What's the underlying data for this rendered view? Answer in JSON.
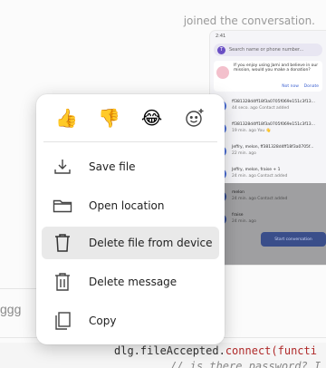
{
  "conversation": {
    "joined_text": "joined the conversation."
  },
  "phone_preview": {
    "status_time": "2:41",
    "search_avatar": "T",
    "search_placeholder": "Search name or phone number...",
    "promo_text": "If you enjoy using Jami and believe in our mission, would you make a donation?",
    "promo_not_now": "Not now",
    "promo_donate": "Donate",
    "rows": [
      {
        "title": "ff381328d4ff18f3a0705f069e151c3f13...",
        "sub": "44 seco. ago  Contact added"
      },
      {
        "title": "ff381328d4ff18f3a0705f069e151c3f13...",
        "sub": "19 min. ago  You 👋"
      },
      {
        "title": "Jeffry, melon, ff381328d4ff18f3a0705f...",
        "sub": "22 min. ago"
      },
      {
        "title": "Jeffry, melon, fraise + 1",
        "sub": "24 min. ago  Contact added"
      },
      {
        "title": "melon",
        "sub": "24 min. ago  Contact added"
      },
      {
        "title": "fraise",
        "sub": "24 min. ago"
      }
    ],
    "fab_label": "Start conversation"
  },
  "composer": {
    "text": "ggg"
  },
  "code": {
    "line1_prefix": "dlg.fileAccepted.",
    "line1_fn": "connect(functi",
    "line2": "// is there password? I"
  },
  "menu": {
    "reactions": [
      {
        "icon": "thumbs-up-icon",
        "glyph": "👍"
      },
      {
        "icon": "thumbs-down-icon",
        "glyph": "👎"
      },
      {
        "icon": "laughing-face-icon",
        "glyph": "😂"
      },
      {
        "icon": "add-reaction-icon",
        "glyph": ""
      }
    ],
    "items": [
      {
        "icon": "download-icon",
        "label": "Save file"
      },
      {
        "icon": "folder-icon",
        "label": "Open location"
      },
      {
        "icon": "trash-icon",
        "label": "Delete file from device"
      },
      {
        "icon": "delete-message-icon",
        "label": "Delete message"
      },
      {
        "icon": "copy-icon",
        "label": "Copy"
      }
    ],
    "highlighted_item": "Delete file from device"
  }
}
